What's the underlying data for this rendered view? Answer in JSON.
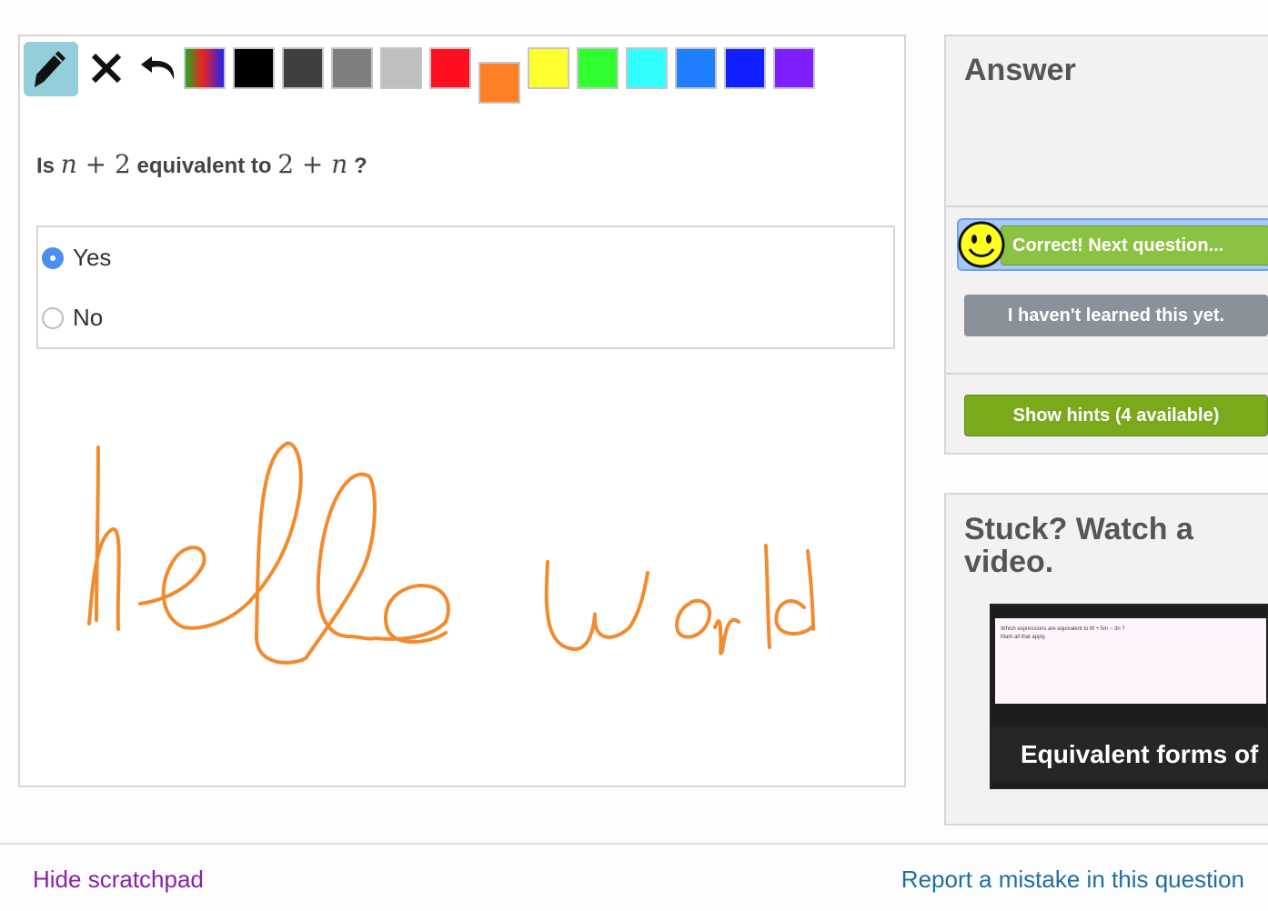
{
  "toolbar": {
    "tools": [
      "pencil-icon",
      "clear-icon",
      "undo-icon"
    ],
    "swatches": [
      {
        "name": "rainbow",
        "color": "rainbow",
        "selected": false
      },
      {
        "name": "black",
        "color": "#000000",
        "selected": false
      },
      {
        "name": "dark-gray",
        "color": "#3f3f3f",
        "selected": false
      },
      {
        "name": "gray",
        "color": "#7f7f7f",
        "selected": false
      },
      {
        "name": "light-gray",
        "color": "#bfbfbf",
        "selected": false
      },
      {
        "name": "red",
        "color": "#ff0f1f",
        "selected": false
      },
      {
        "name": "orange",
        "color": "#ff7f27",
        "selected": true
      },
      {
        "name": "yellow",
        "color": "#ffff2f",
        "selected": false
      },
      {
        "name": "green",
        "color": "#2fff2f",
        "selected": false
      },
      {
        "name": "cyan",
        "color": "#2fffff",
        "selected": false
      },
      {
        "name": "light-blue",
        "color": "#1f7fff",
        "selected": false
      },
      {
        "name": "blue",
        "color": "#0f1fff",
        "selected": false
      },
      {
        "name": "purple",
        "color": "#7f1fff",
        "selected": false
      }
    ]
  },
  "question": {
    "prefix": "Is",
    "expr1_var": "n",
    "expr1_rest": " + 2",
    "middle": "equivalent to",
    "expr2_num": "2 + ",
    "expr2_var": "n",
    "suffix": "?"
  },
  "choices": [
    {
      "label": "Yes",
      "checked": true
    },
    {
      "label": "No",
      "checked": false
    }
  ],
  "scratchpad": {
    "stroke_color": "#f28a2e"
  },
  "answer_panel": {
    "title": "Answer",
    "correct_label": "Correct! Next question...",
    "not_learned_label": "I haven't learned this yet.",
    "hints_label": "Show hints (4 available)"
  },
  "video_panel": {
    "title": "Stuck? Watch a video.",
    "thumb_question": "Which expressions are equivalent to 6f + 5m − 3n ?",
    "thumb_sub": "Mark all that apply.",
    "video_label": "Equivalent forms of expressions"
  },
  "footer": {
    "hide_scratchpad": "Hide scratchpad",
    "report_mistake": "Report a mistake in this question"
  },
  "colors": {
    "accent_blue": "#4b90f0",
    "correct_green": "#8cc243",
    "hint_green": "#79aa1c",
    "link_purple": "#8b1fa8",
    "link_blue": "#1d6fa0"
  }
}
